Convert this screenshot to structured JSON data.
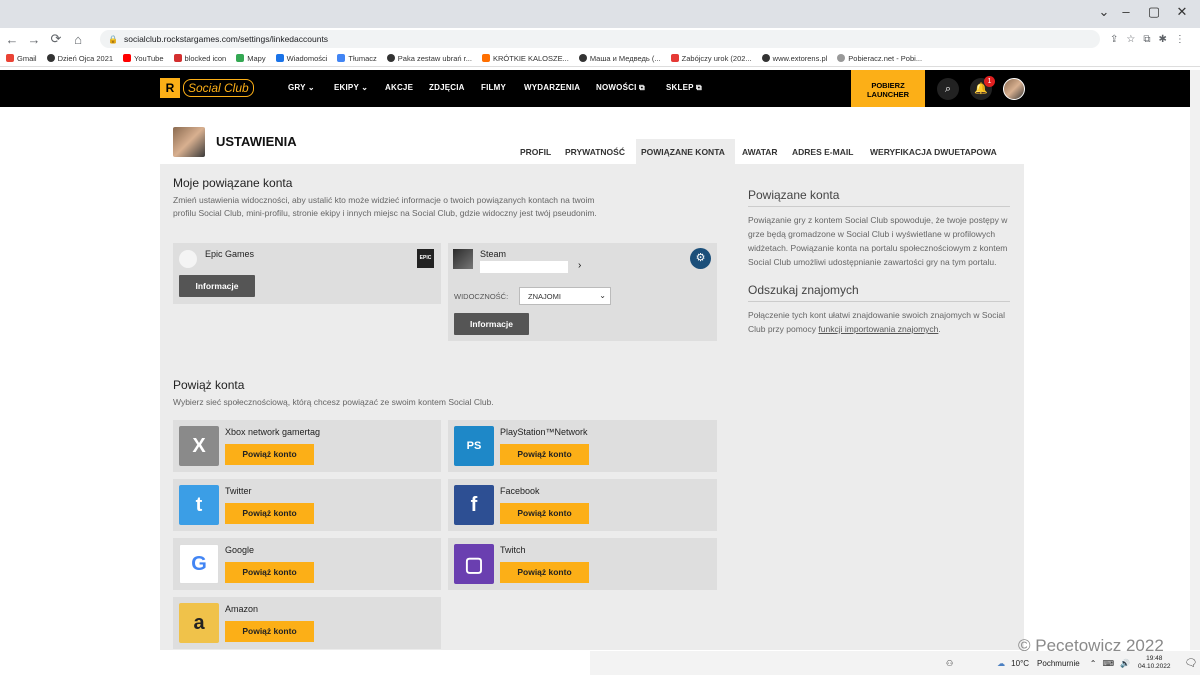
{
  "browser": {
    "url": "socialclub.rockstargames.com/settings/linkedaccounts",
    "bookmarks": [
      "Gmail",
      "Dzień Ojca 2021",
      "YouTube",
      "blocked icon",
      "Mapy",
      "Wiadomości",
      "Tłumacz",
      "Paka zestaw ubrań r...",
      "KRÓTKIE KALOSZE...",
      "Маша и Медведь (...",
      "Zabójczy urok (202...",
      "www.extorens.pl",
      "Pobieracz.net - Pobi..."
    ]
  },
  "nav": {
    "logo_r": "R",
    "logo_text": "Social Club",
    "items": [
      "GRY",
      "EKIPY",
      "AKCJE",
      "ZDJĘCIA",
      "FILMY",
      "WYDARZENIA",
      "NOWOŚCI",
      "SKLEP"
    ],
    "launcher": [
      "POBIERZ",
      "LAUNCHER"
    ],
    "notif_count": "1"
  },
  "header": {
    "title": "USTAWIENIA",
    "tabs": [
      "PROFIL",
      "PRYWATNOŚĆ",
      "POWIĄZANE KONTA",
      "AWATAR",
      "ADRES E-MAIL",
      "WERYFIKACJA DWUETAPOWA"
    ]
  },
  "linked": {
    "title": "Moje powiązane konta",
    "desc": "Zmień ustawienia widoczności, aby ustalić kto może widzieć informacje o twoich powiązanych kontach na twoim profilu Social Club, mini-profilu, stronie ekipy i innych miejsc na Social Club, gdzie widoczny jest twój pseudonim.",
    "epic": {
      "name": "Epic Games",
      "badge": "EPIC",
      "button": "Informacje"
    },
    "steam": {
      "name": "Steam",
      "visibility_label": "WIDOCZNOŚĆ:",
      "visibility_value": "ZNAJOMI",
      "button": "Informacje"
    }
  },
  "connect": {
    "title": "Powiąż konta",
    "desc": "Wybierz sieć społecznościową, którą chcesz powiązać ze swoim kontem Social Club.",
    "button": "Powiąż konto",
    "services": [
      {
        "name": "Xbox network gamertag",
        "color": "#8a8a8a",
        "glyph": "X"
      },
      {
        "name": "PlayStation™Network",
        "color": "#1e88c8",
        "glyph": "PS"
      },
      {
        "name": "Twitter",
        "color": "#3b9ee6",
        "glyph": "t"
      },
      {
        "name": "Facebook",
        "color": "#2d4f93",
        "glyph": "f"
      },
      {
        "name": "Google",
        "color": "#ffffff",
        "glyph": "G"
      },
      {
        "name": "Twitch",
        "color": "#6a3fb0",
        "glyph": "▢"
      },
      {
        "name": "Amazon",
        "color": "#f0c24a",
        "glyph": "a"
      }
    ]
  },
  "side": {
    "h1": "Powiązane konta",
    "p1": "Powiązanie gry z kontem Social Club spowoduje, że twoje postępy w grze będą gromadzone w Social Club i wyświetlane w profilowych widżetach. Powiązanie konta na portalu społecznościowym z kontem Social Club umożliwi udostępnianie zawartości gry na tym portalu.",
    "h2": "Odszukaj znajomych",
    "p2a": "Połączenie tych kont ułatwi znajdowanie swoich znajomych w Social Club przy pomocy ",
    "p2link": "funkcji importowania znajomych",
    "p2b": "."
  },
  "taskbar": {
    "temp": "10°C",
    "weather": "Pochmurnie",
    "time": "19:48",
    "date": "04.10.2022"
  },
  "watermark": "© Pecetowicz 2022"
}
